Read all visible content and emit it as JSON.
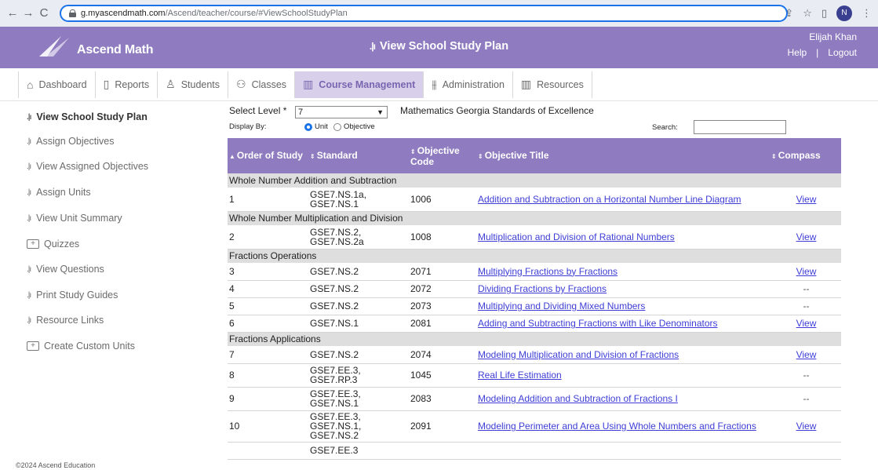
{
  "browser": {
    "url_domain": "g.myascendmath.com",
    "url_path": "/Ascend/teacher/course/#ViewSchoolStudyPlan",
    "profile_initial": "N"
  },
  "header": {
    "logo_text": "Ascend Math",
    "title": "View School Study Plan",
    "user_name": "Elijah Khan",
    "help_label": "Help",
    "separator": "|",
    "logout_label": "Logout",
    "bg_color": "#8f7cc0"
  },
  "tabs": [
    {
      "label": "Dashboard",
      "icon": "home-icon"
    },
    {
      "label": "Reports",
      "icon": "document-icon"
    },
    {
      "label": "Students",
      "icon": "person-icon"
    },
    {
      "label": "Classes",
      "icon": "group-icon"
    },
    {
      "label": "Course Management",
      "icon": "map-icon",
      "active": true
    },
    {
      "label": "Administration",
      "icon": "sliders-icon"
    },
    {
      "label": "Resources",
      "icon": "map-icon"
    }
  ],
  "sidebar": {
    "items": [
      {
        "label": "View School Study Plan",
        "icon": "bars-icon",
        "active": true
      },
      {
        "label": "Assign Objectives",
        "icon": "bars-icon"
      },
      {
        "label": "View Assigned Objectives",
        "icon": "bars-icon"
      },
      {
        "label": "Assign Units",
        "icon": "bars-icon"
      },
      {
        "label": "View Unit Summary",
        "icon": "bars-icon"
      },
      {
        "label": "Quizzes",
        "icon": "folder-plus-icon"
      },
      {
        "label": "View Questions",
        "icon": "bars-icon"
      },
      {
        "label": "Print Study Guides",
        "icon": "bars-icon"
      },
      {
        "label": "Resource Links",
        "icon": "bars-icon"
      },
      {
        "label": "Create Custom Units",
        "icon": "folder-plus-icon"
      }
    ]
  },
  "controls": {
    "select_level_label": "Select Level *",
    "level_value": "7",
    "standard_name": "Mathematics Georgia Standards of Excellence",
    "display_by_label": "Display By:",
    "radio_unit": "Unit",
    "radio_objective": "Objective",
    "search_label": "Search:"
  },
  "table": {
    "headers": {
      "order": "Order of Study",
      "standard": "Standard",
      "code": "Objective Code",
      "title": "Objective Title",
      "compass": "Compass"
    },
    "groups": [
      {
        "name": "Whole Number Addition and Subtraction",
        "rows": [
          {
            "order": "1",
            "standard": "GSE7.NS.1a,\nGSE7.NS.1",
            "code": "1006",
            "title": "Addition and Subtraction on a Horizontal Number Line Diagram",
            "compass": "View"
          }
        ]
      },
      {
        "name": "Whole Number Multiplication and Division",
        "rows": [
          {
            "order": "2",
            "standard": "GSE7.NS.2,\nGSE7.NS.2a",
            "code": "1008",
            "title": "Multiplication and Division of Rational Numbers",
            "compass": "View"
          }
        ]
      },
      {
        "name": "Fractions Operations",
        "rows": [
          {
            "order": "3",
            "standard": "GSE7.NS.2",
            "code": "2071",
            "title": "Multiplying Fractions by Fractions",
            "compass": "View"
          },
          {
            "order": "4",
            "standard": "GSE7.NS.2",
            "code": "2072",
            "title": "Dividing Fractions by Fractions",
            "compass": "--"
          },
          {
            "order": "5",
            "standard": "GSE7.NS.2",
            "code": "2073",
            "title": "Multiplying and Dividing Mixed Numbers",
            "compass": "--"
          },
          {
            "order": "6",
            "standard": "GSE7.NS.1",
            "code": "2081",
            "title": "Adding and Subtracting Fractions with Like Denominators",
            "compass": "View"
          }
        ]
      },
      {
        "name": "Fractions Applications",
        "rows": [
          {
            "order": "7",
            "standard": "GSE7.NS.2",
            "code": "2074",
            "title": "Modeling Multiplication and Division of Fractions",
            "compass": "View"
          },
          {
            "order": "8",
            "standard": "GSE7.EE.3,\nGSE7.RP.3",
            "code": "1045",
            "title": "Real Life Estimation",
            "compass": "--"
          },
          {
            "order": "9",
            "standard": "GSE7.EE.3,\nGSE7.NS.1",
            "code": "2083",
            "title": "Modeling Addition and Subtraction of Fractions I",
            "compass": "--"
          },
          {
            "order": "10",
            "standard": "GSE7.EE.3,\nGSE7.NS.1,\nGSE7.NS.2",
            "code": "2091",
            "title": "Modeling Perimeter and Area Using Whole Numbers and Fractions",
            "compass": "View"
          },
          {
            "order": "",
            "standard": "GSE7.EE.3",
            "code": "",
            "title": "",
            "compass": ""
          }
        ]
      }
    ]
  },
  "footer": {
    "copyright": "©2024 Ascend Education"
  }
}
